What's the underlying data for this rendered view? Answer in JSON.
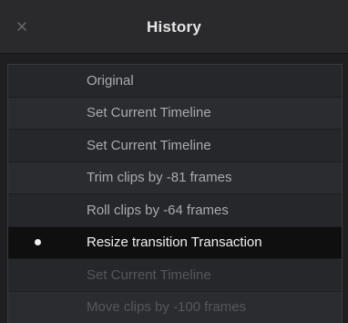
{
  "window": {
    "title": "History"
  },
  "history": {
    "items": [
      {
        "label": "Original",
        "state": "past"
      },
      {
        "label": "Set Current Timeline",
        "state": "past"
      },
      {
        "label": "Set Current Timeline",
        "state": "past"
      },
      {
        "label": "Trim clips by -81 frames",
        "state": "past"
      },
      {
        "label": "Roll clips by -64 frames",
        "state": "past"
      },
      {
        "label": "Resize transition Transaction",
        "state": "current"
      },
      {
        "label": "Set Current Timeline",
        "state": "future"
      },
      {
        "label": "Move clips by -100 frames",
        "state": "future"
      }
    ]
  },
  "icons": {
    "close": "close-icon",
    "current_marker": "current-state-dot-icon"
  },
  "colors": {
    "current_row_bg": "#0f0f10",
    "past_text": "#a9abaf",
    "current_text": "#f2f2f2",
    "future_text": "#55575b"
  }
}
